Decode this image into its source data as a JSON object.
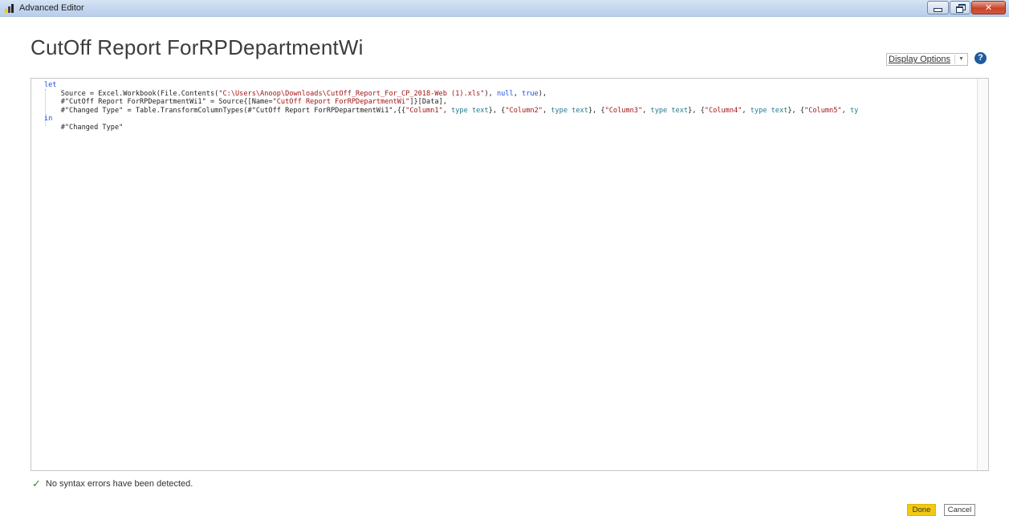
{
  "window": {
    "title": "Advanced Editor",
    "controls": {
      "minimize_icon": "minimize-icon",
      "maximize_icon": "restore-icon",
      "close_label": "✕"
    }
  },
  "header": {
    "query_title": "CutOff Report ForRPDepartmentWi",
    "display_options_label": "Display Options",
    "display_options_chevron": "▼",
    "help_label": "?"
  },
  "editor": {
    "lines": [
      [
        {
          "t": "let",
          "c": "kw"
        }
      ],
      [
        {
          "t": "    Source = Excel.Workbook(File.Contents(",
          "c": ""
        },
        {
          "t": "\"C:\\Users\\Anoop\\Downloads\\CutOff_Report_For_CP_2018-Web (1).xls\"",
          "c": "str"
        },
        {
          "t": "), ",
          "c": ""
        },
        {
          "t": "null",
          "c": "nul"
        },
        {
          "t": ", ",
          "c": ""
        },
        {
          "t": "true",
          "c": "kw"
        },
        {
          "t": "),",
          "c": ""
        }
      ],
      [
        {
          "t": "    #\"CutOff Report ForRPDepartmentWi1\" = Source{[Name=",
          "c": ""
        },
        {
          "t": "\"CutOff Report ForRPDepartmentWi\"",
          "c": "str"
        },
        {
          "t": "]}[Data],",
          "c": ""
        }
      ],
      [
        {
          "t": "    #\"Changed Type\" = Table.TransformColumnTypes(#\"CutOff Report ForRPDepartmentWi1\",{{",
          "c": ""
        },
        {
          "t": "\"Column1\"",
          "c": "str"
        },
        {
          "t": ", ",
          "c": ""
        },
        {
          "t": "type text",
          "c": "typ"
        },
        {
          "t": "}, {",
          "c": ""
        },
        {
          "t": "\"Column2\"",
          "c": "str"
        },
        {
          "t": ", ",
          "c": ""
        },
        {
          "t": "type text",
          "c": "typ"
        },
        {
          "t": "}, {",
          "c": ""
        },
        {
          "t": "\"Column3\"",
          "c": "str"
        },
        {
          "t": ", ",
          "c": ""
        },
        {
          "t": "type text",
          "c": "typ"
        },
        {
          "t": "}, {",
          "c": ""
        },
        {
          "t": "\"Column4\"",
          "c": "str"
        },
        {
          "t": ", ",
          "c": ""
        },
        {
          "t": "type text",
          "c": "typ"
        },
        {
          "t": "}, {",
          "c": ""
        },
        {
          "t": "\"Column5\"",
          "c": "str"
        },
        {
          "t": ", ",
          "c": ""
        },
        {
          "t": "ty",
          "c": "typ"
        }
      ],
      [
        {
          "t": "in",
          "c": "kw"
        }
      ],
      [
        {
          "t": "    #\"Changed Type\"",
          "c": ""
        }
      ]
    ]
  },
  "status": {
    "icon": "checkmark-icon",
    "message": "No syntax errors have been detected."
  },
  "buttons": {
    "done": "Done",
    "cancel": "Cancel"
  },
  "colors": {
    "accent": "#f2c811",
    "keyword": "#1c4fd8",
    "string": "#a31515",
    "type": "#1f7a8c",
    "success": "#2e8b3a"
  }
}
